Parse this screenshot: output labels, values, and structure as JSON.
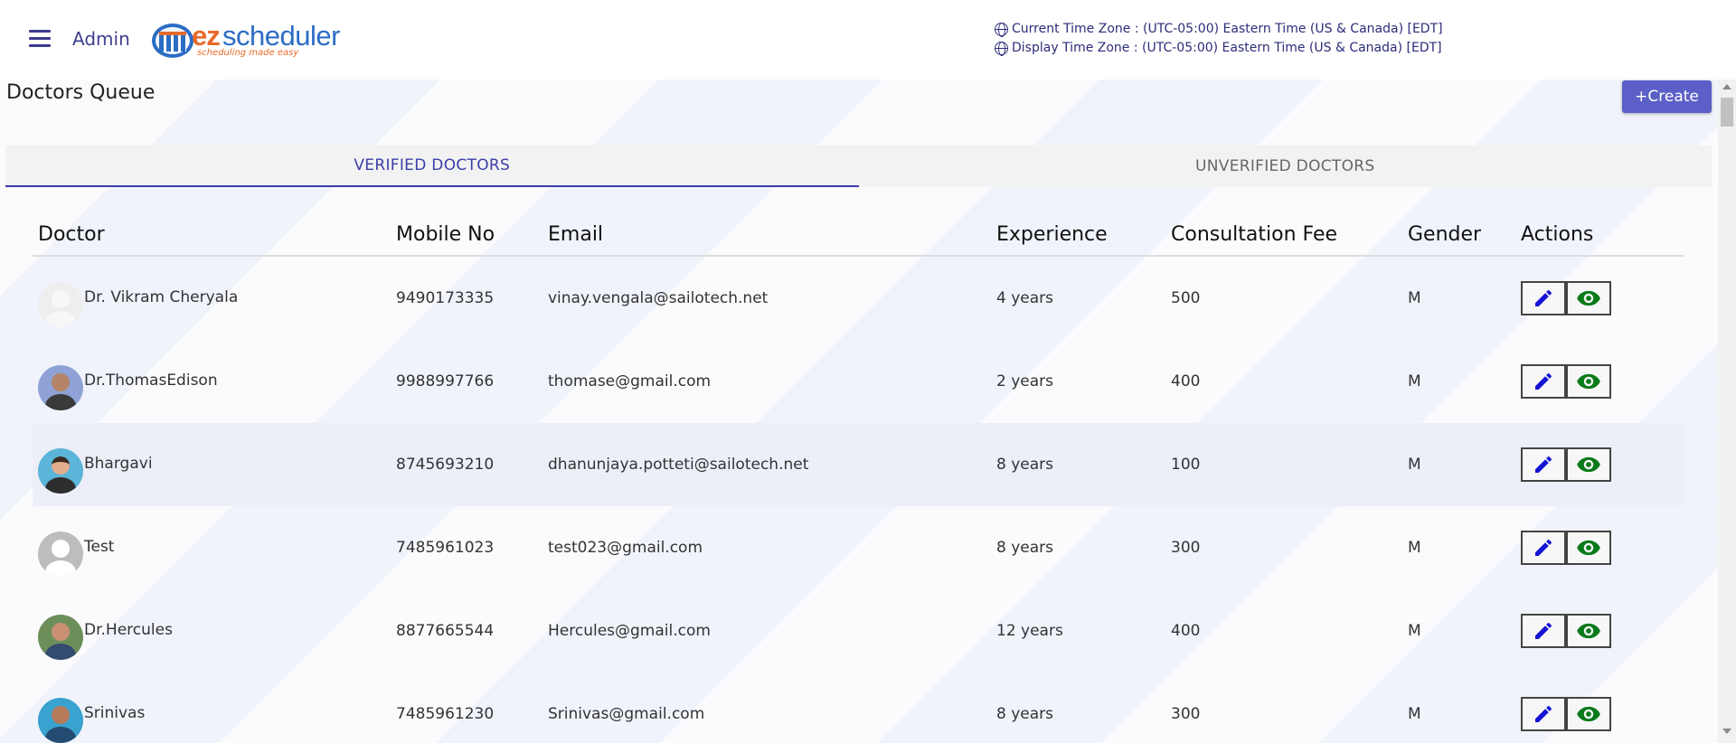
{
  "header": {
    "menu_icon": "hamburger-menu-icon",
    "admin_label": "Admin",
    "logo": {
      "ez": "ez",
      "scheduler": "scheduler",
      "tagline": "scheduling made easy"
    },
    "current_time_zone": "Current Time Zone : (UTC-05:00) Eastern Time (US & Canada) [EDT]",
    "display_time_zone": "Display Time Zone : (UTC-05:00) Eastern Time (US & Canada) [EDT]"
  },
  "page": {
    "title": "Doctors Queue",
    "create_label": "+Create"
  },
  "tabs": [
    {
      "label": "VERIFIED DOCTORS",
      "active": true
    },
    {
      "label": "UNVERIFIED DOCTORS",
      "active": false
    }
  ],
  "table": {
    "columns": [
      "Doctor",
      "Mobile No",
      "Email",
      "Experience",
      "Consultation Fee",
      "Gender",
      "Actions"
    ],
    "rows": [
      {
        "doctor": "Dr. Vikram Cheryala",
        "mobile": "9490173335",
        "email": "vinay.vengala@sailotech.net",
        "experience": "4 years",
        "fee": "500",
        "gender": "M"
      },
      {
        "doctor": "Dr.ThomasEdison",
        "mobile": "9988997766",
        "email": "thomase@gmail.com",
        "experience": "2 years",
        "fee": "400",
        "gender": "M"
      },
      {
        "doctor": "Bhargavi",
        "mobile": "8745693210",
        "email": "dhanunjaya.potteti@sailotech.net",
        "experience": "8 years",
        "fee": "100",
        "gender": "M"
      },
      {
        "doctor": "Test",
        "mobile": "7485961023",
        "email": "test023@gmail.com",
        "experience": "8 years",
        "fee": "300",
        "gender": "M"
      },
      {
        "doctor": "Dr.Hercules",
        "mobile": "8877665544",
        "email": "Hercules@gmail.com",
        "experience": "12 years",
        "fee": "400",
        "gender": "M"
      },
      {
        "doctor": "Srinivas",
        "mobile": "7485961230",
        "email": "Srinivas@gmail.com",
        "experience": "8 years",
        "fee": "300",
        "gender": "M"
      }
    ]
  },
  "colors": {
    "accent": "#3a3ea8",
    "create_button": "#5b5fc7",
    "edit_icon": "#1414d4",
    "view_icon": "#0a7a1a",
    "row_highlight": "#eceff8"
  }
}
